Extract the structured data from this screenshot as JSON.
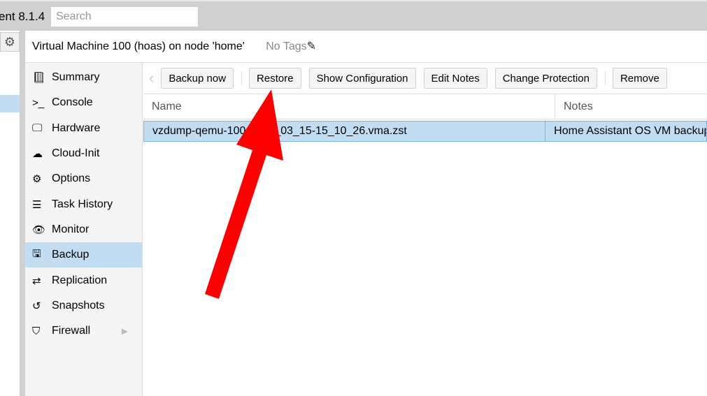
{
  "topbar": {
    "version": "ent 8.1.4",
    "search_placeholder": "Search"
  },
  "header": {
    "title": "Virtual Machine 100 (hoas) on node 'home'",
    "tags": "No Tags"
  },
  "nav": [
    {
      "label": "Summary",
      "icon": "book-icon"
    },
    {
      "label": "Console",
      "icon": "terminal-icon"
    },
    {
      "label": "Hardware",
      "icon": "desktop-icon"
    },
    {
      "label": "Cloud-Init",
      "icon": "cloud-icon"
    },
    {
      "label": "Options",
      "icon": "gear-icon"
    },
    {
      "label": "Task History",
      "icon": "list-icon"
    },
    {
      "label": "Monitor",
      "icon": "eye-icon"
    },
    {
      "label": "Backup",
      "icon": "floppy-icon",
      "active": true
    },
    {
      "label": "Replication",
      "icon": "retweet-icon"
    },
    {
      "label": "Snapshots",
      "icon": "history-icon"
    },
    {
      "label": "Firewall",
      "icon": "shield-icon"
    }
  ],
  "toolbar": {
    "backup_now": "Backup now",
    "restore": "Restore",
    "show_config": "Show Configuration",
    "edit_notes": "Edit Notes",
    "change_protection": "Change Protection",
    "remove": "Remove"
  },
  "grid": {
    "columns": [
      "Name",
      "Notes"
    ],
    "rows": [
      {
        "name": "vzdump-qemu-100-2024_03_15-15_10_26.vma.zst",
        "notes": "Home Assistant OS VM backup"
      }
    ]
  },
  "annotation": {
    "arrow_color": "#ff0000"
  }
}
